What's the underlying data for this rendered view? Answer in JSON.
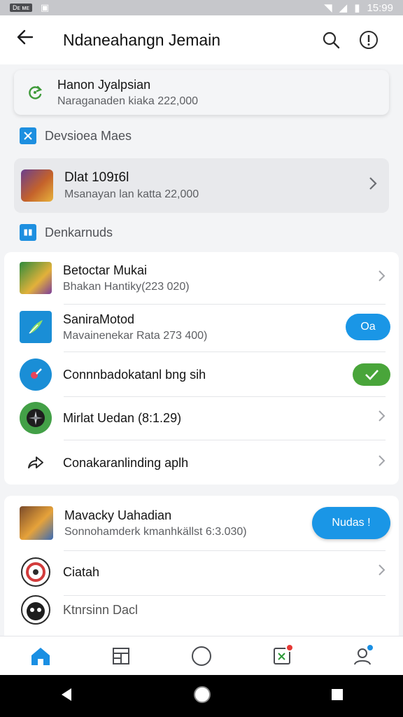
{
  "status_bar": {
    "left_badge": "Dᴇ ᴍᴇ",
    "time": "15:99"
  },
  "app_bar": {
    "title": "Ndaneahangn Jemain"
  },
  "top_card": {
    "title": "Hanon Jyalpsian",
    "subtitle": "Naraganaden kiaka 222,000"
  },
  "section1": {
    "label": "Devsioea Maes"
  },
  "featured": {
    "title": "Dlat 109ɪ6l",
    "subtitle": "Msanayan lan katta 22,000"
  },
  "section2": {
    "label": "Denkarnuds"
  },
  "list": [
    {
      "title": "Betoctar Mukai",
      "subtitle": "Bhakan Hantiky(223 020)"
    },
    {
      "title": "SaniraMotod",
      "subtitle": "Mavainenekar Rata 273 400)",
      "action_label": "Oa"
    },
    {
      "title": "Connnbadokatanl bng sih"
    },
    {
      "title": "Mirlat Uedan (8:1.29)"
    },
    {
      "title": "Conakaranlinding aplh"
    }
  ],
  "list2": [
    {
      "title": "Mavacky Uahadian",
      "subtitle": "Sonnohamderk kmanhkällst 6:3.030)",
      "action_label": "Nudas !"
    },
    {
      "title": "Ciatah"
    },
    {
      "title": "Ktnrsinn Dacl"
    }
  ],
  "colors": {
    "accent": "#1a96e6",
    "success": "#49a53a",
    "badge_red": "#e53935"
  }
}
